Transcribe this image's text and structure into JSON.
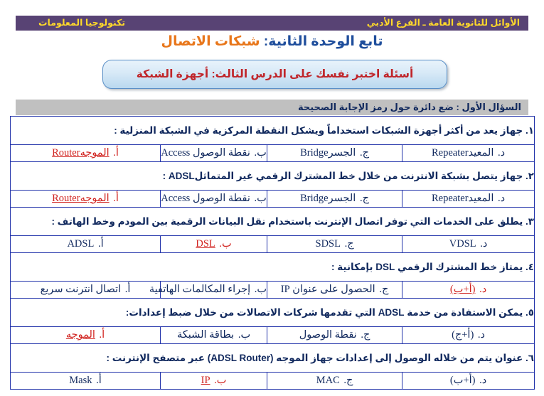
{
  "banner": {
    "right_text": "الأوائل للثانوية العامة  ـ  الفرع الأدبي",
    "left_text": "تكنولوجيا المعلومات",
    "bg_color": "#584374",
    "text_color": "#ffd92a"
  },
  "title": {
    "part_blue": "تابع الوحدة الثانية:",
    "part_orange": " شبكات الاتصال",
    "blue_color": "#1f4e9c",
    "orange_color": "#e8761a"
  },
  "subtitle": {
    "text": "أسئلة اختبر نفسك على الدرس الثالث: أجهزة الشبكة",
    "text_color": "#c0252a",
    "border_color": "#5a8fc7"
  },
  "instruction": {
    "text": "السؤال الأول : ضع دائرة حول رمز الإجابة الصحيحة",
    "bg_color": "#c0c0c0",
    "text_color": "#11295e"
  },
  "table": {
    "border_color": "#2233aa",
    "text_color": "#11295e",
    "correct_color": "#d1231f"
  },
  "questions": [
    {
      "number": "١.",
      "stem": "جهاز يعد من أكثر أجهزة الشبكات استخداماً ويشكل النقطة المركزية في الشبكة المنزلية :",
      "options": [
        {
          "letter": "د.",
          "answer": "المعيدRepeater",
          "correct": false
        },
        {
          "letter": "ج.",
          "answer": "الجسرBridge",
          "correct": false
        },
        {
          "letter": "ب.",
          "answer": "نقطة الوصول Access",
          "correct": false
        },
        {
          "letter": "أ.",
          "answer": "الموجهRouter",
          "correct": true
        }
      ]
    },
    {
      "number": "٢.",
      "stem": "جهاز يتصل بشبكة الانترنت من خلال خط المشترك الرقمي غير المتماثلADSL  :",
      "options": [
        {
          "letter": "د.",
          "answer": "المعيدRepeater",
          "correct": false
        },
        {
          "letter": "ج.",
          "answer": "الجسرBridge",
          "correct": false
        },
        {
          "letter": "ب.",
          "answer": "نقطة الوصول Access",
          "correct": false
        },
        {
          "letter": "أ.",
          "answer": "الموجهRouter",
          "correct": true
        }
      ]
    },
    {
      "number": "٣.",
      "stem": "يطلق على الخدمات التي توفر اتصال الإنترنت باستخدام نقل البيانات الرقمية بين المودم وخط الهاتف :",
      "options": [
        {
          "letter": "د.",
          "answer": "VDSL",
          "correct": false
        },
        {
          "letter": "ج.",
          "answer": "SDSL",
          "correct": false
        },
        {
          "letter": "ب.",
          "answer": "DSL",
          "correct": true
        },
        {
          "letter": "أ.",
          "answer": "ADSL",
          "correct": false
        }
      ]
    },
    {
      "number": "٤.",
      "stem": "يمتاز خط المشترك الرقمي DSL  بإمكانية :",
      "options": [
        {
          "letter": "د.",
          "answer": "(أ+ب)",
          "correct": true
        },
        {
          "letter": "ج.",
          "answer": "الحصول على عنوان IP",
          "correct": false
        },
        {
          "letter": "ب.",
          "answer": "إجراء المكالمات الهاتفية",
          "correct": false
        },
        {
          "letter": "أ.",
          "answer": "اتصال انترنت سريع",
          "correct": false
        }
      ]
    },
    {
      "number": "٥.",
      "stem": "يمكن الاستفادة من خدمة ADSL التي تقدمها شركات الاتصالات من خلال ضبط إعدادات:",
      "options": [
        {
          "letter": "د.",
          "answer": "(أ+ج)",
          "correct": false
        },
        {
          "letter": "ج.",
          "answer": "نقطة الوصول",
          "correct": false
        },
        {
          "letter": "ب.",
          "answer": "بطاقة الشبكة",
          "correct": false
        },
        {
          "letter": "أ.",
          "answer": "الموجه",
          "correct": true
        }
      ]
    },
    {
      "number": "٦.",
      "stem": "عنوان  يتم من خلاله الوصول إلى إعدادات جهاز الموجه (ADSL Router) عبر متصفح الإنترنت :",
      "options": [
        {
          "letter": "د.",
          "answer": "(أ+ب)",
          "correct": false
        },
        {
          "letter": "ج.",
          "answer": "MAC",
          "correct": false
        },
        {
          "letter": "ب.",
          "answer": "IP",
          "correct": true
        },
        {
          "letter": "أ.",
          "answer": "Mask",
          "correct": false
        }
      ]
    }
  ]
}
